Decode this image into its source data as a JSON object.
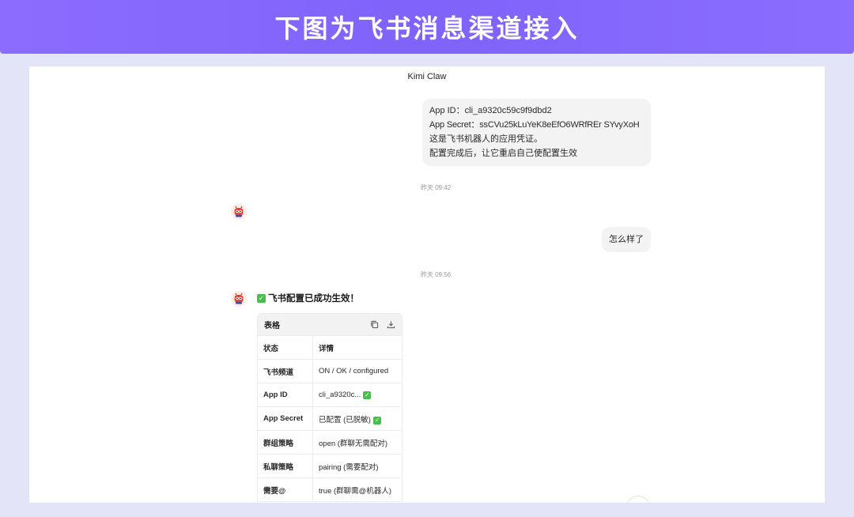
{
  "banner": {
    "title": "下图为飞书消息渠道接入"
  },
  "window": {
    "title": "Kimi Claw"
  },
  "messages": {
    "credentials": {
      "line1": "App ID：cli_a9320c59c9f9dbd2",
      "line2": "App Secret：ssCVu25kLuYeK8eEfO6WRfREr SYvyXoH",
      "line3": "这是飞书机器人的应用凭证。",
      "line4": "配置完成后，让它重启自己使配置生效"
    },
    "timestamp_1": "昨天 09:42",
    "question": "怎么样了",
    "timestamp_2": "昨天 09:56",
    "reply_title": "飞书配置已成功生效！"
  },
  "table": {
    "title": "表格",
    "headers": [
      "状态",
      "详情"
    ],
    "rows": [
      {
        "key": "飞书频道",
        "value": "ON / OK / configured",
        "check": false
      },
      {
        "key": "App ID",
        "value": "cli_a9320c...",
        "check": true
      },
      {
        "key": "App Secret",
        "value": "已配置 (已脱敏)",
        "check": true
      },
      {
        "key": "群组策略",
        "value": "open (群聊无需配对)",
        "check": false
      },
      {
        "key": "私聊策略",
        "value": "pairing (需要配对)",
        "check": false
      },
      {
        "key": "需要@",
        "value": "true (群聊需@机器人)",
        "check": false
      }
    ]
  },
  "icons": {
    "avatar": "robot-avatar-icon",
    "success": "check-mark-icon",
    "copy": "copy-icon",
    "download": "download-icon"
  },
  "colors": {
    "banner": "#7f63fa",
    "background": "#e4e4f9",
    "bubble": "#f3f3f3",
    "success": "#46c04a"
  }
}
